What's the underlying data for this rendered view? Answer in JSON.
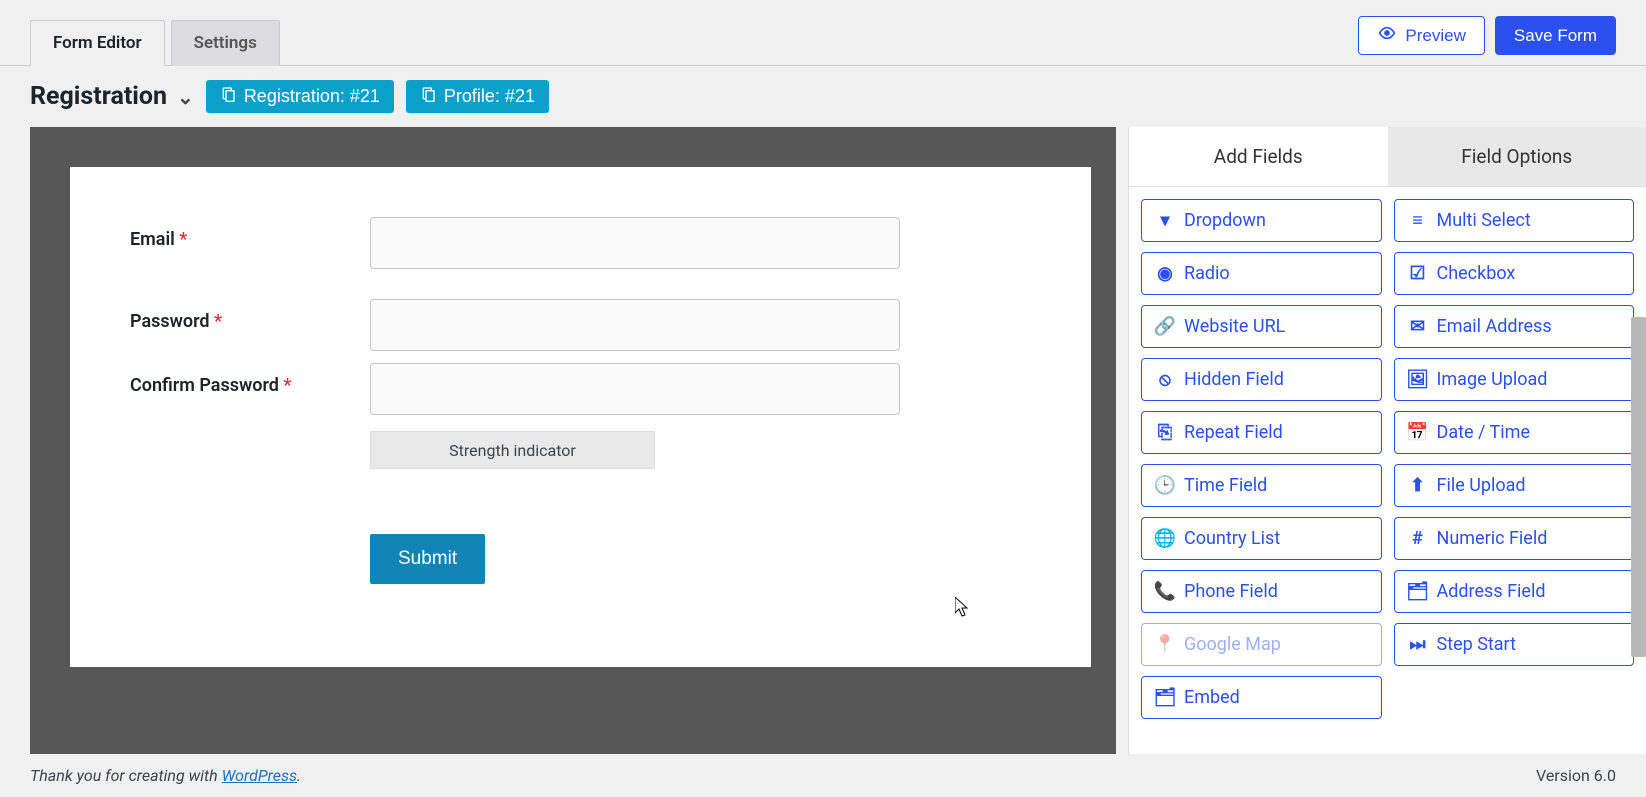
{
  "tabs": {
    "editor": "Form Editor",
    "settings": "Settings"
  },
  "actions": {
    "preview": "Preview",
    "save": "Save Form"
  },
  "header": {
    "title": "Registration",
    "pill_registration": "Registration: #21",
    "pill_profile": "Profile: #21"
  },
  "form": {
    "email_label": "Email",
    "password_label": "Password",
    "confirm_label": "Confirm Password",
    "strength": "Strength indicator",
    "submit": "Submit",
    "asterisk": "*"
  },
  "side": {
    "tab_add": "Add Fields",
    "tab_options": "Field Options",
    "fields": [
      {
        "label": "Dropdown",
        "icon": "▾"
      },
      {
        "label": "Multi Select",
        "icon": "≡"
      },
      {
        "label": "Radio",
        "icon": "◉"
      },
      {
        "label": "Checkbox",
        "icon": "☑"
      },
      {
        "label": "Website URL",
        "icon": "🔗"
      },
      {
        "label": "Email Address",
        "icon": "✉"
      },
      {
        "label": "Hidden Field",
        "icon": "⦸"
      },
      {
        "label": "Image Upload",
        "icon": "🖼"
      },
      {
        "label": "Repeat Field",
        "icon": "⎘"
      },
      {
        "label": "Date / Time",
        "icon": "📅"
      },
      {
        "label": "Time Field",
        "icon": "🕒"
      },
      {
        "label": "File Upload",
        "icon": "⬆"
      },
      {
        "label": "Country List",
        "icon": "🌐"
      },
      {
        "label": "Numeric Field",
        "icon": "#"
      },
      {
        "label": "Phone Field",
        "icon": "📞"
      },
      {
        "label": "Address Field",
        "icon": "🗂"
      },
      {
        "label": "Google Map",
        "icon": "📍",
        "disabled": true
      },
      {
        "label": "Step Start",
        "icon": "⏭"
      },
      {
        "label": "Embed",
        "icon": "🗂"
      }
    ]
  },
  "footer": {
    "thankyou_prefix": "Thank you for creating with ",
    "wp_link": "WordPress",
    "thankyou_suffix": ".",
    "version": "Version 6.0"
  }
}
